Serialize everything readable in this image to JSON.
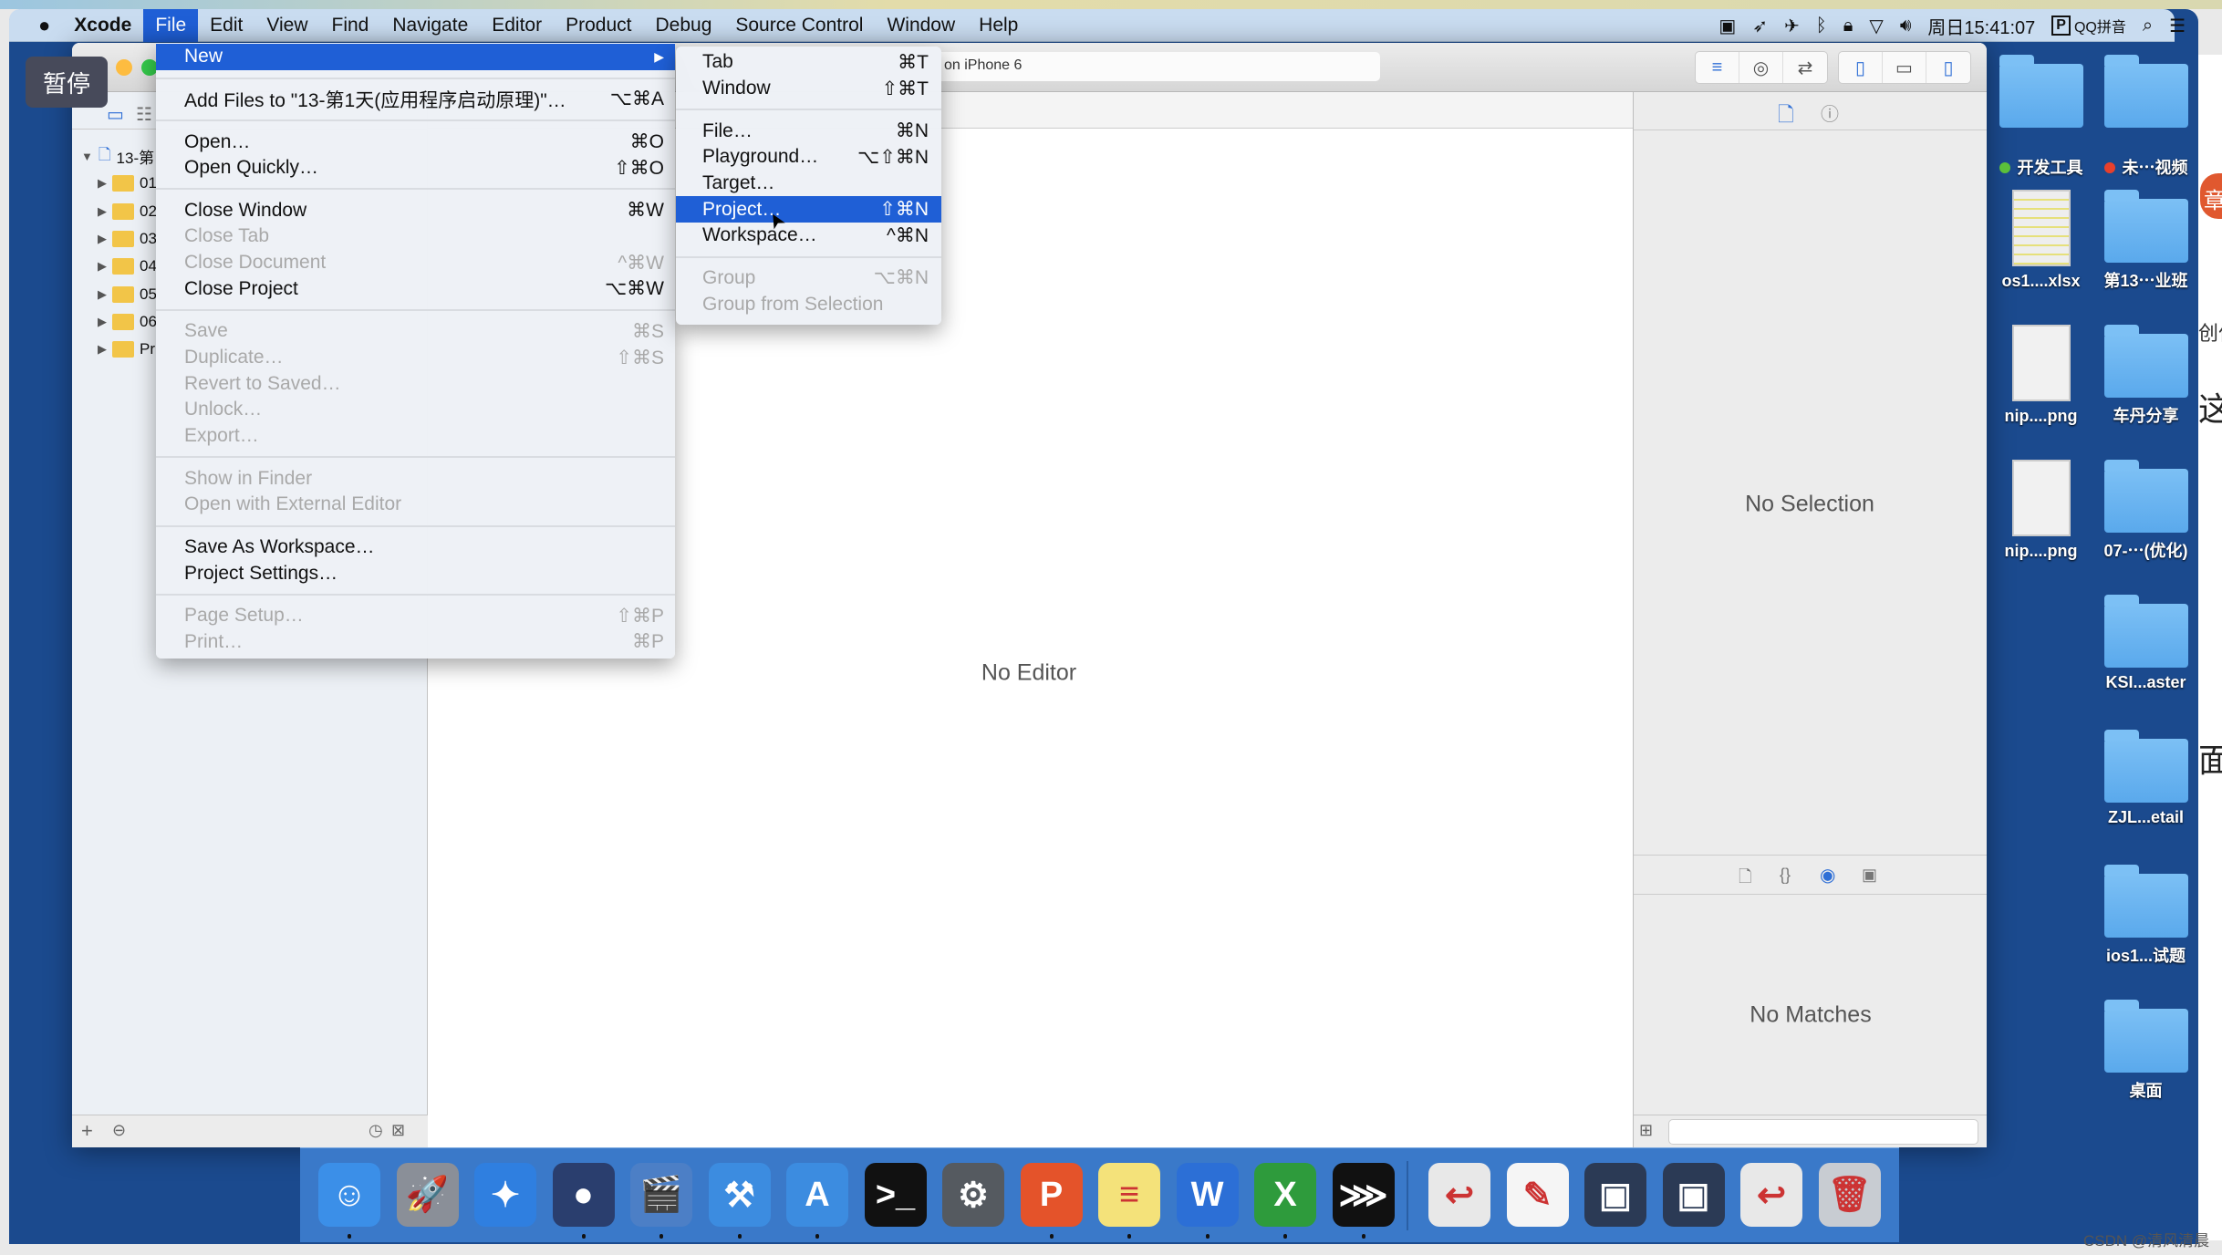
{
  "menubar": {
    "app": "Xcode",
    "items": [
      "File",
      "Edit",
      "View",
      "Find",
      "Navigate",
      "Editor",
      "Product",
      "Debug",
      "Source Control",
      "Window",
      "Help"
    ],
    "active": "File",
    "status": {
      "clock": "周日15:41:07",
      "input_method": "QQ拼音",
      "icons": [
        "screen-record-icon",
        "location-icon",
        "airplane-icon",
        "bluetooth-icon",
        "lock-icon",
        "wifi-icon",
        "volume-icon",
        "input-method-icon",
        "spotlight-icon",
        "notification-center-icon"
      ]
    }
  },
  "overlay": {
    "pause": "暂停"
  },
  "toolbar": {
    "activity": "on iPhone 6"
  },
  "navigator": {
    "rows": [
      {
        "label": "13-第",
        "type": "project",
        "open": true
      },
      {
        "label": "01",
        "type": "folder"
      },
      {
        "label": "02",
        "type": "folder"
      },
      {
        "label": "03",
        "type": "folder"
      },
      {
        "label": "04",
        "type": "folder"
      },
      {
        "label": "05",
        "type": "folder"
      },
      {
        "label": "06",
        "type": "folder"
      },
      {
        "label": "Pr",
        "type": "folder"
      }
    ]
  },
  "editor": {
    "placeholder": "No Editor"
  },
  "utilities": {
    "inspector_placeholder": "No Selection",
    "library_placeholder": "No Matches"
  },
  "file_menu": [
    {
      "label": "New",
      "submenu": true,
      "highlighted": true
    },
    {
      "sep": true
    },
    {
      "label": "Add Files to \"13-第1天(应用程序启动原理)\"…",
      "shortcut": "⌥⌘A"
    },
    {
      "sep": true
    },
    {
      "label": "Open…",
      "shortcut": "⌘O"
    },
    {
      "label": "Open Quickly…",
      "shortcut": "⇧⌘O"
    },
    {
      "sep": true
    },
    {
      "label": "Close Window",
      "shortcut": "⌘W"
    },
    {
      "label": "Close Tab",
      "disabled": true
    },
    {
      "label": "Close Document",
      "shortcut": "^⌘W",
      "disabled": true
    },
    {
      "label": "Close Project",
      "shortcut": "⌥⌘W"
    },
    {
      "sep": true
    },
    {
      "label": "Save",
      "shortcut": "⌘S",
      "disabled": true
    },
    {
      "label": "Duplicate…",
      "shortcut": "⇧⌘S",
      "disabled": true
    },
    {
      "label": "Revert to Saved…",
      "disabled": true
    },
    {
      "label": "Unlock…",
      "disabled": true
    },
    {
      "label": "Export…",
      "disabled": true
    },
    {
      "sep": true
    },
    {
      "label": "Show in Finder",
      "disabled": true
    },
    {
      "label": "Open with External Editor",
      "disabled": true
    },
    {
      "sep": true
    },
    {
      "label": "Save As Workspace…"
    },
    {
      "label": "Project Settings…"
    },
    {
      "sep": true
    },
    {
      "label": "Page Setup…",
      "shortcut": "⇧⌘P",
      "disabled": true
    },
    {
      "label": "Print…",
      "shortcut": "⌘P",
      "disabled": true
    }
  ],
  "new_submenu": [
    {
      "label": "Tab",
      "shortcut": "⌘T"
    },
    {
      "label": "Window",
      "shortcut": "⇧⌘T"
    },
    {
      "sep": true
    },
    {
      "label": "File…",
      "shortcut": "⌘N"
    },
    {
      "label": "Playground…",
      "shortcut": "⌥⇧⌘N"
    },
    {
      "label": "Target…"
    },
    {
      "label": "Project…",
      "shortcut": "⇧⌘N",
      "highlighted": true
    },
    {
      "label": "Workspace…",
      "shortcut": "^⌘N"
    },
    {
      "sep": true
    },
    {
      "label": "Group",
      "shortcut": "⌥⌘N",
      "disabled": true
    },
    {
      "label": "Group from Selection",
      "disabled": true
    }
  ],
  "desktop": [
    {
      "label": "",
      "type": "folder",
      "col": 0
    },
    {
      "label": "",
      "type": "folder",
      "col": 1
    },
    {
      "label": "开发工具",
      "type": "tag-green",
      "col": 0
    },
    {
      "label": "未⋯视频",
      "type": "tag-red",
      "col": 1
    },
    {
      "label": "os1....xlsx",
      "type": "xlsx",
      "col": 0
    },
    {
      "label": "第13⋯业班",
      "type": "folder",
      "col": 1
    },
    {
      "label": "nip....png",
      "type": "png",
      "col": 0
    },
    {
      "label": "车丹分享",
      "type": "folder",
      "col": 1
    },
    {
      "label": "nip....png",
      "type": "png",
      "col": 0
    },
    {
      "label": "07-⋯(优化)",
      "type": "folder",
      "col": 1
    },
    {
      "label": "KSI...aster",
      "type": "folder",
      "col": 1
    },
    {
      "label": "ZJL...etail",
      "type": "folder",
      "col": 1
    },
    {
      "label": "ios1...试题",
      "type": "folder",
      "col": 1
    },
    {
      "label": "桌面",
      "type": "folder",
      "col": 1
    }
  ],
  "dock": [
    {
      "name": "finder",
      "glyph": "☺",
      "color": "#3b8fe8",
      "running": true
    },
    {
      "name": "launchpad",
      "glyph": "🚀",
      "color": "#8a8f98",
      "running": false
    },
    {
      "name": "safari",
      "glyph": "✦",
      "color": "#2f7fe0",
      "running": false
    },
    {
      "name": "mouse-app",
      "glyph": "●",
      "color": "#2a3e6e",
      "running": true
    },
    {
      "name": "imovie",
      "glyph": "🎬",
      "color": "#4c7fc6",
      "running": true
    },
    {
      "name": "xcode",
      "glyph": "⚒",
      "color": "#3c8ce0",
      "running": true
    },
    {
      "name": "instruments",
      "glyph": "A",
      "color": "#3c8ce0",
      "running": true
    },
    {
      "name": "terminal",
      "glyph": ">_",
      "color": "#111111",
      "running": false
    },
    {
      "name": "system-preferences",
      "glyph": "⚙",
      "color": "#555a60",
      "running": false
    },
    {
      "name": "powerpoint",
      "glyph": "P",
      "color": "#e4532a",
      "running": true
    },
    {
      "name": "notes",
      "glyph": "≡",
      "color": "#f4e27a",
      "running": true
    },
    {
      "name": "word",
      "glyph": "W",
      "color": "#2c6fd6",
      "running": true
    },
    {
      "name": "excel",
      "glyph": "X",
      "color": "#2e9b3c",
      "running": true
    },
    {
      "name": "console",
      "glyph": "⋙",
      "color": "#111111",
      "running": true
    },
    {
      "name": "document-1",
      "glyph": "↩",
      "color": "#e8e8e8",
      "running": false
    },
    {
      "name": "document-2",
      "glyph": "✎",
      "color": "#f5f5f5",
      "running": false
    },
    {
      "name": "screenshot-1",
      "glyph": "▣",
      "color": "#2b3a55",
      "running": false
    },
    {
      "name": "screenshot-2",
      "glyph": "▣",
      "color": "#2b3a55",
      "running": false
    },
    {
      "name": "document-3",
      "glyph": "↩",
      "color": "#e8e8e8",
      "running": false
    },
    {
      "name": "trash",
      "glyph": "🗑",
      "color": "#c8ccd2",
      "running": false
    }
  ],
  "right_page": {
    "badge": "章",
    "text1": "创作",
    "text2": "这",
    "text3": "面"
  },
  "watermark": "CSDN @清风清晨",
  "colors": {
    "menu_highlight": "#1f5fd6",
    "desktop": "#1b4a8e",
    "dock": "#3a79c9"
  }
}
